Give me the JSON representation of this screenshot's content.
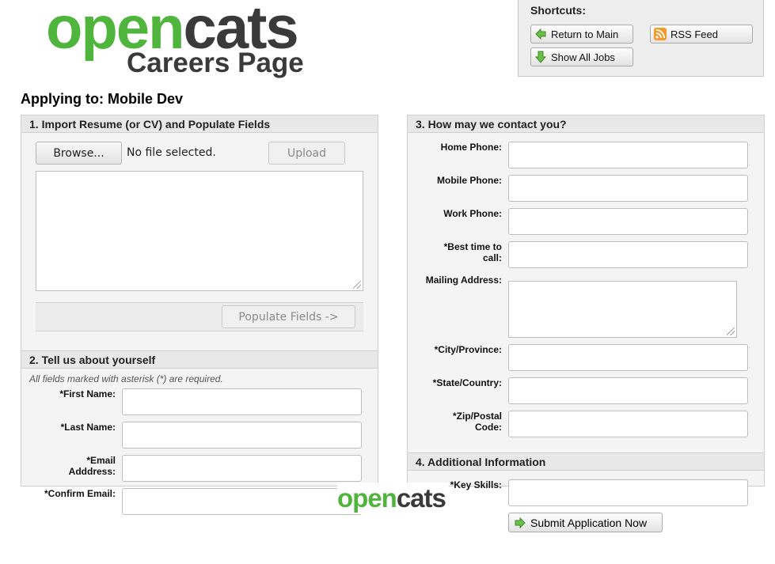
{
  "logo": {
    "open": "open",
    "cats": "cats",
    "subtitle": "Careers Page"
  },
  "shortcuts": {
    "title": "Shortcuts:",
    "return_main": "Return to Main",
    "rss_feed": "RSS Feed",
    "show_all_jobs": "Show All Jobs"
  },
  "applying_to": "Applying to: Mobile Dev",
  "section1": {
    "title": "1. Import Resume (or CV) and Populate Fields",
    "browse_label": "Browse...",
    "file_status": "No file selected.",
    "upload_label": "Upload",
    "resume_text": "",
    "populate_label": "Populate Fields ->"
  },
  "section2": {
    "title": "2. Tell us about yourself",
    "note": "All fields marked with asterisk (*) are required.",
    "first_name_label": "*First Name:",
    "last_name_label": "*Last Name:",
    "email_label_line1": "*Email",
    "email_label_line2": "Adddress:",
    "confirm_email_label": "*Confirm Email:",
    "first_name": "",
    "last_name": "",
    "email": "",
    "confirm_email": ""
  },
  "section3": {
    "title": "3. How may we contact you?",
    "home_phone_label": "Home Phone:",
    "mobile_phone_label": "Mobile Phone:",
    "work_phone_label": "Work Phone:",
    "best_time_line1": "*Best time to",
    "best_time_line2": "call:",
    "mailing_address_label": "Mailing Address:",
    "city_label": "*City/Province:",
    "state_label": "*State/Country:",
    "zip_line1": "*Zip/Postal",
    "zip_line2": "Code:"
  },
  "section4": {
    "title": "4. Additional Information",
    "key_skills_label": "*Key Skills:"
  },
  "submit_label": "Submit Application Now",
  "footer_logo": {
    "open": "open",
    "cats": "cats"
  },
  "colors": {
    "brand_green": "#4fb53c",
    "brand_dark": "#3a3a3a",
    "panel_bg": "#f4f4f4",
    "rss_orange": "#f39a2b"
  }
}
